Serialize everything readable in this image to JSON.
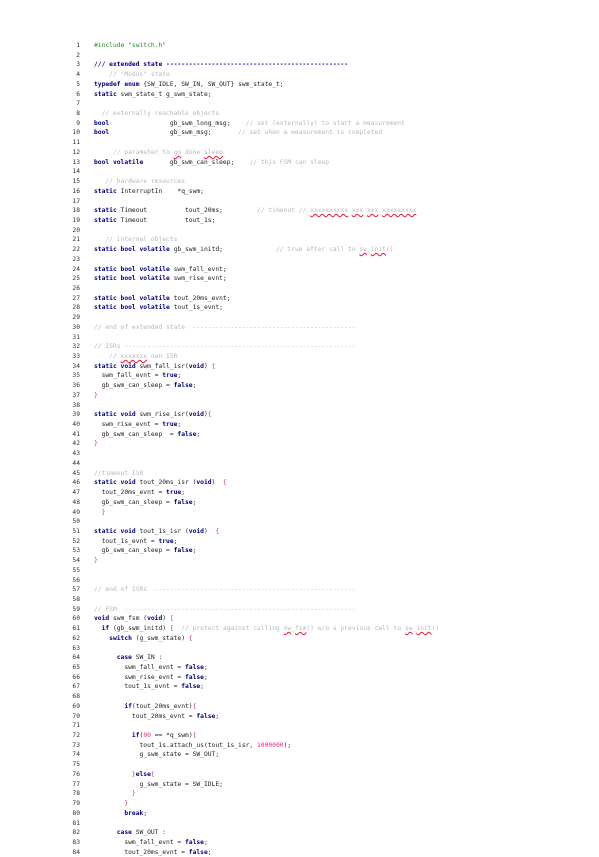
{
  "lines": [
    {
      "n": "1",
      "tokens": [
        {
          "t": "#include \"switch.h\"",
          "c": "pp"
        }
      ]
    },
    {
      "n": "2",
      "tokens": []
    },
    {
      "n": "3",
      "tokens": [
        {
          "t": "/// extended state ",
          "c": "kw"
        },
        {
          "t": "------------------------------------------------",
          "c": "kw"
        }
      ]
    },
    {
      "n": "4",
      "tokens": [
        {
          "t": "    // \"Modus\" state",
          "c": "cm"
        }
      ]
    },
    {
      "n": "5",
      "tokens": [
        {
          "t": "typedef enum ",
          "c": "kw"
        },
        {
          "t": "{SW_IDLE, SW_IN, SW_OUT} swm_state_t;",
          "c": "pl"
        }
      ]
    },
    {
      "n": "6",
      "tokens": [
        {
          "t": "static ",
          "c": "kw"
        },
        {
          "t": "swm_state_t g_swm_state;",
          "c": "pl"
        }
      ]
    },
    {
      "n": "7",
      "tokens": []
    },
    {
      "n": "8",
      "tokens": [
        {
          "t": "  // externally reachable objects",
          "c": "cm"
        }
      ]
    },
    {
      "n": "9",
      "tokens": [
        {
          "t": "bool",
          "c": "kw"
        },
        {
          "t": "                gb_swm_long_msg;",
          "c": "pl"
        },
        {
          "t": "    // set (externally) to start a measurement",
          "c": "cm"
        }
      ]
    },
    {
      "n": "10",
      "tokens": [
        {
          "t": "bool",
          "c": "kw"
        },
        {
          "t": "                gb_swm_msg;",
          "c": "pl"
        },
        {
          "t": "       // set when a measurement is completed",
          "c": "cm"
        }
      ]
    },
    {
      "n": "11",
      "tokens": []
    },
    {
      "n": "12",
      "tokens": [
        {
          "t": "     // parameter to ",
          "c": "cm"
        },
        {
          "t": "go",
          "c": "cm",
          "w": true
        },
        {
          "t": " done ",
          "c": "cm"
        },
        {
          "t": "sleep",
          "c": "cm",
          "w": true
        }
      ]
    },
    {
      "n": "13",
      "tokens": [
        {
          "t": "bool volatile",
          "c": "kw"
        },
        {
          "t": "       gb_swm_can_sleep;",
          "c": "pl"
        },
        {
          "t": "    // this FSM can sleep",
          "c": "cm"
        }
      ]
    },
    {
      "n": "14",
      "tokens": []
    },
    {
      "n": "15",
      "tokens": [
        {
          "t": "   // hardware resources",
          "c": "cm"
        }
      ]
    },
    {
      "n": "16",
      "tokens": [
        {
          "t": "static ",
          "c": "kw"
        },
        {
          "t": "InterruptIn    *q_swm;",
          "c": "pl"
        }
      ]
    },
    {
      "n": "17",
      "tokens": []
    },
    {
      "n": "18",
      "tokens": [
        {
          "t": "static ",
          "c": "kw"
        },
        {
          "t": "Timeout          tout_20ms;",
          "c": "pl"
        },
        {
          "t": "         // timeout // ",
          "c": "cm"
        },
        {
          "t": "xxxxxxxxxx",
          "c": "cm",
          "w": true
        },
        {
          "t": " ",
          "c": "cm"
        },
        {
          "t": "xxx",
          "c": "cm",
          "w": true
        },
        {
          "t": " ",
          "c": "cm"
        },
        {
          "t": "xxx",
          "c": "cm",
          "w": true
        },
        {
          "t": " ",
          "c": "cm"
        },
        {
          "t": "xxxxxxxxx",
          "c": "cm",
          "w": true
        }
      ]
    },
    {
      "n": "19",
      "tokens": [
        {
          "t": "static ",
          "c": "kw"
        },
        {
          "t": "Timeout          tout_1s;",
          "c": "pl"
        }
      ]
    },
    {
      "n": "20",
      "tokens": []
    },
    {
      "n": "21",
      "tokens": [
        {
          "t": "   // internal objects",
          "c": "cm"
        }
      ]
    },
    {
      "n": "22",
      "tokens": [
        {
          "t": "static bool volatile ",
          "c": "kw"
        },
        {
          "t": "gb_swm_initd;",
          "c": "pl"
        },
        {
          "t": "              // true after call to ",
          "c": "cm"
        },
        {
          "t": "sw",
          "c": "cm",
          "w": true
        },
        {
          "t": "_",
          "c": "cm"
        },
        {
          "t": "init",
          "c": "cm",
          "w": true
        },
        {
          "t": "()",
          "c": "cm"
        }
      ]
    },
    {
      "n": "23",
      "tokens": []
    },
    {
      "n": "24",
      "tokens": [
        {
          "t": "static bool volatile ",
          "c": "kw"
        },
        {
          "t": "swm_fall_evnt;",
          "c": "pl"
        }
      ]
    },
    {
      "n": "25",
      "tokens": [
        {
          "t": "static bool volatile ",
          "c": "kw"
        },
        {
          "t": "swm_rise_evnt;",
          "c": "pl"
        }
      ]
    },
    {
      "n": "26",
      "tokens": []
    },
    {
      "n": "27",
      "tokens": [
        {
          "t": "static bool volatile ",
          "c": "kw"
        },
        {
          "t": "tout_20ms_evnt;",
          "c": "pl"
        }
      ]
    },
    {
      "n": "28",
      "tokens": [
        {
          "t": "static bool volatile ",
          "c": "kw"
        },
        {
          "t": "tout_1s_evnt;",
          "c": "pl"
        }
      ]
    },
    {
      "n": "29",
      "tokens": []
    },
    {
      "n": "30",
      "tokens": [
        {
          "t": "// end of extended state  -------------------------------------------",
          "c": "cm"
        }
      ]
    },
    {
      "n": "31",
      "tokens": []
    },
    {
      "n": "32",
      "tokens": [
        {
          "t": "// ISRs -------------------------------------------------------------",
          "c": "cm"
        }
      ]
    },
    {
      "n": "33",
      "tokens": [
        {
          "t": "    // ",
          "c": "cm"
        },
        {
          "t": "xxxxxxx",
          "c": "cm",
          "w": true
        },
        {
          "t": " own ISR",
          "c": "cm"
        }
      ]
    },
    {
      "n": "34",
      "tokens": [
        {
          "t": "static void ",
          "c": "kw"
        },
        {
          "t": "swm_fall_isr(",
          "c": "pl"
        },
        {
          "t": "void",
          "c": "kw"
        },
        {
          "t": ") ",
          "c": "pl"
        },
        {
          "t": "{",
          "c": "nm"
        }
      ]
    },
    {
      "n": "35",
      "tokens": [
        {
          "t": "  swm_fall_evnt = ",
          "c": "pl"
        },
        {
          "t": "true",
          "c": "kw"
        },
        {
          "t": ";",
          "c": "pl"
        }
      ]
    },
    {
      "n": "36",
      "tokens": [
        {
          "t": "  gb_swm_can_sleep = ",
          "c": "pl"
        },
        {
          "t": "false",
          "c": "kw"
        },
        {
          "t": ";",
          "c": "pl"
        }
      ]
    },
    {
      "n": "37",
      "tokens": [
        {
          "t": "}",
          "c": "nm"
        }
      ]
    },
    {
      "n": "38",
      "tokens": []
    },
    {
      "n": "39",
      "tokens": [
        {
          "t": "static void ",
          "c": "kw"
        },
        {
          "t": "swm_rise_isr(",
          "c": "pl"
        },
        {
          "t": "void",
          "c": "kw"
        },
        {
          "t": ")",
          "c": "pl"
        },
        {
          "t": "{",
          "c": "nm"
        }
      ]
    },
    {
      "n": "40",
      "tokens": [
        {
          "t": "  swm_rise_evnt = ",
          "c": "pl"
        },
        {
          "t": "true",
          "c": "kw"
        },
        {
          "t": ";",
          "c": "pl"
        }
      ]
    },
    {
      "n": "41",
      "tokens": [
        {
          "t": "  gb_swm_can_sleep  = ",
          "c": "pl"
        },
        {
          "t": "false",
          "c": "kw"
        },
        {
          "t": ";",
          "c": "pl"
        }
      ]
    },
    {
      "n": "42",
      "tokens": [
        {
          "t": "}",
          "c": "nm"
        }
      ]
    },
    {
      "n": "43",
      "tokens": []
    },
    {
      "n": "44",
      "tokens": []
    },
    {
      "n": "45",
      "tokens": [
        {
          "t": "//timeout ISR",
          "c": "cm"
        }
      ]
    },
    {
      "n": "46",
      "tokens": [
        {
          "t": "static void ",
          "c": "kw"
        },
        {
          "t": "tout_20ms_isr (",
          "c": "pl"
        },
        {
          "t": "void",
          "c": "kw"
        },
        {
          "t": ")  ",
          "c": "pl"
        },
        {
          "t": "{",
          "c": "nm"
        }
      ]
    },
    {
      "n": "47",
      "tokens": [
        {
          "t": "  tout_20ms_evnt = ",
          "c": "pl"
        },
        {
          "t": "true",
          "c": "kw"
        },
        {
          "t": ";",
          "c": "pl"
        }
      ]
    },
    {
      "n": "48",
      "tokens": [
        {
          "t": "  gb_swm_can_sleep = ",
          "c": "pl"
        },
        {
          "t": "false",
          "c": "kw"
        },
        {
          "t": ";",
          "c": "pl"
        }
      ]
    },
    {
      "n": "49",
      "tokens": [
        {
          "t": "  }",
          "c": "nm"
        }
      ]
    },
    {
      "n": "50",
      "tokens": []
    },
    {
      "n": "51",
      "tokens": [
        {
          "t": "static void ",
          "c": "kw"
        },
        {
          "t": "tout_1s_isr (",
          "c": "pl"
        },
        {
          "t": "void",
          "c": "kw"
        },
        {
          "t": ")  ",
          "c": "pl"
        },
        {
          "t": "{",
          "c": "nm"
        }
      ]
    },
    {
      "n": "52",
      "tokens": [
        {
          "t": "  tout_1s_evnt = ",
          "c": "pl"
        },
        {
          "t": "true",
          "c": "kw"
        },
        {
          "t": ";",
          "c": "pl"
        }
      ]
    },
    {
      "n": "53",
      "tokens": [
        {
          "t": "  gb_swm_can_sleep = ",
          "c": "pl"
        },
        {
          "t": "false",
          "c": "kw"
        },
        {
          "t": ";",
          "c": "pl"
        }
      ]
    },
    {
      "n": "54",
      "tokens": [
        {
          "t": "}",
          "c": "nm"
        }
      ]
    },
    {
      "n": "55",
      "tokens": []
    },
    {
      "n": "56",
      "tokens": []
    },
    {
      "n": "57",
      "tokens": [
        {
          "t": "// end of ISRs  -----------------------------------------------------",
          "c": "cm"
        }
      ]
    },
    {
      "n": "58",
      "tokens": []
    },
    {
      "n": "59",
      "tokens": [
        {
          "t": "// FSM  -------------------------------------------------------------",
          "c": "cm"
        }
      ]
    },
    {
      "n": "60",
      "tokens": [
        {
          "t": "void ",
          "c": "kw"
        },
        {
          "t": "swm_fsm (",
          "c": "pl"
        },
        {
          "t": "void",
          "c": "kw"
        },
        {
          "t": ") ",
          "c": "pl"
        },
        {
          "t": "{",
          "c": "nm"
        }
      ]
    },
    {
      "n": "61",
      "tokens": [
        {
          "t": "  ",
          "c": "pl"
        },
        {
          "t": "if ",
          "c": "kw"
        },
        {
          "t": "(gb_swm_initd) ",
          "c": "pl"
        },
        {
          "t": "{",
          "c": "nm"
        },
        {
          "t": "  // protect against calling ",
          "c": "cm"
        },
        {
          "t": "sw",
          "c": "cm",
          "w": true
        },
        {
          "t": "_",
          "c": "cm"
        },
        {
          "t": "fsm",
          "c": "cm",
          "w": true
        },
        {
          "t": "() w/o a previous call to ",
          "c": "cm"
        },
        {
          "t": "sw",
          "c": "cm",
          "w": true
        },
        {
          "t": "_",
          "c": "cm"
        },
        {
          "t": "init",
          "c": "cm",
          "w": true
        },
        {
          "t": "()",
          "c": "cm"
        }
      ]
    },
    {
      "n": "62",
      "tokens": [
        {
          "t": "    ",
          "c": "pl"
        },
        {
          "t": "switch ",
          "c": "kw"
        },
        {
          "t": "(g_swm_state) ",
          "c": "pl"
        },
        {
          "t": "{",
          "c": "nm"
        }
      ]
    },
    {
      "n": "63",
      "tokens": []
    },
    {
      "n": "64",
      "tokens": [
        {
          "t": "      ",
          "c": "pl"
        },
        {
          "t": "case ",
          "c": "kw"
        },
        {
          "t": "SW_IN :",
          "c": "pl"
        }
      ]
    },
    {
      "n": "65",
      "tokens": [
        {
          "t": "        swm_fall_evnt = ",
          "c": "pl"
        },
        {
          "t": "false",
          "c": "kw"
        },
        {
          "t": ";",
          "c": "pl"
        }
      ]
    },
    {
      "n": "66",
      "tokens": [
        {
          "t": "        swm_rise_evnt = ",
          "c": "pl"
        },
        {
          "t": "false",
          "c": "kw"
        },
        {
          "t": ";",
          "c": "pl"
        }
      ]
    },
    {
      "n": "67",
      "tokens": [
        {
          "t": "        tout_1s_evnt = ",
          "c": "pl"
        },
        {
          "t": "false",
          "c": "kw"
        },
        {
          "t": ";",
          "c": "pl"
        }
      ]
    },
    {
      "n": "68",
      "tokens": []
    },
    {
      "n": "69",
      "tokens": [
        {
          "t": "        ",
          "c": "pl"
        },
        {
          "t": "if",
          "c": "kw"
        },
        {
          "t": "(tout_20ms_evnt)",
          "c": "pl"
        },
        {
          "t": "{",
          "c": "nm"
        }
      ]
    },
    {
      "n": "70",
      "tokens": [
        {
          "t": "          tout_20ms_evnt = ",
          "c": "pl"
        },
        {
          "t": "false",
          "c": "kw"
        },
        {
          "t": ";",
          "c": "pl"
        }
      ]
    },
    {
      "n": "71",
      "tokens": []
    },
    {
      "n": "72",
      "tokens": [
        {
          "t": "          ",
          "c": "pl"
        },
        {
          "t": "if",
          "c": "kw"
        },
        {
          "t": "(",
          "c": "pl"
        },
        {
          "t": "00",
          "c": "nm"
        },
        {
          "t": " == *q_swm)",
          "c": "pl"
        },
        {
          "t": "{",
          "c": "nm"
        }
      ]
    },
    {
      "n": "73",
      "tokens": [
        {
          "t": "            tout_1s.attach_us(tout_1s_isr, ",
          "c": "pl"
        },
        {
          "t": "1000000",
          "c": "nm"
        },
        {
          "t": ");",
          "c": "pl"
        }
      ]
    },
    {
      "n": "74",
      "tokens": [
        {
          "t": "            g_swm_state = SW_OUT;",
          "c": "pl"
        }
      ]
    },
    {
      "n": "75",
      "tokens": []
    },
    {
      "n": "76",
      "tokens": [
        {
          "t": "          ",
          "c": "pl"
        },
        {
          "t": "}",
          "c": "nm"
        },
        {
          "t": "else",
          "c": "kw"
        },
        {
          "t": "{",
          "c": "nm"
        }
      ]
    },
    {
      "n": "77",
      "tokens": [
        {
          "t": "            g_swm_state = SW_IDLE;",
          "c": "pl"
        }
      ]
    },
    {
      "n": "78",
      "tokens": [
        {
          "t": "          ",
          "c": "pl"
        },
        {
          "t": "}",
          "c": "nm"
        }
      ]
    },
    {
      "n": "79",
      "tokens": [
        {
          "t": "        ",
          "c": "pl"
        },
        {
          "t": "}",
          "c": "nm"
        }
      ]
    },
    {
      "n": "80",
      "tokens": [
        {
          "t": "        ",
          "c": "pl"
        },
        {
          "t": "break",
          "c": "kw"
        },
        {
          "t": ";",
          "c": "pl"
        }
      ]
    },
    {
      "n": "81",
      "tokens": []
    },
    {
      "n": "82",
      "tokens": [
        {
          "t": "      ",
          "c": "pl"
        },
        {
          "t": "case ",
          "c": "kw"
        },
        {
          "t": "SW_OUT :",
          "c": "pl"
        }
      ]
    },
    {
      "n": "83",
      "tokens": [
        {
          "t": "        swm_fall_evnt = ",
          "c": "pl"
        },
        {
          "t": "false",
          "c": "kw"
        },
        {
          "t": ";",
          "c": "pl"
        }
      ]
    },
    {
      "n": "84",
      "tokens": [
        {
          "t": "        tout_20ms_evnt = ",
          "c": "pl"
        },
        {
          "t": "false",
          "c": "kw"
        },
        {
          "t": ";",
          "c": "pl"
        }
      ]
    }
  ]
}
